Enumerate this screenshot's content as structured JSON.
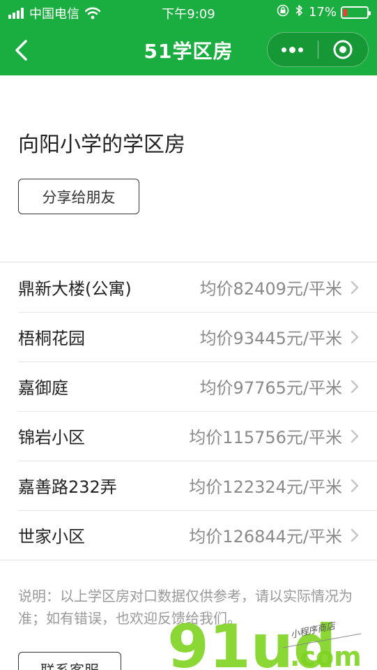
{
  "status_bar": {
    "carrier": "中国电信",
    "time": "下午9:09",
    "battery_percent": "17%",
    "battery_level": 0.17,
    "battery_color": "#ff3b30"
  },
  "header": {
    "title": "51学区房",
    "background_color": "#1aad3f"
  },
  "page": {
    "heading": "向阳小学的学区房",
    "share_button_label": "分享给朋友",
    "listings": [
      {
        "name": "鼎新大楼(公寓)",
        "price": "均价82409元/平米"
      },
      {
        "name": "梧桐花园",
        "price": "均价93445元/平米"
      },
      {
        "name": "嘉御庭",
        "price": "均价97765元/平米"
      },
      {
        "name": "锦岩小区",
        "price": "均价115756元/平米"
      },
      {
        "name": "嘉善路232弄",
        "price": "均价122324元/平米"
      },
      {
        "name": "世家小区",
        "price": "均价126844元/平米"
      }
    ],
    "notice": "说明：以上学区房对口数据仅供参考，请以实际情况为准；如有错误，也欢迎反馈给我们。",
    "contact_button_label": "联系客服"
  },
  "watermark": {
    "logo_text": "91ud",
    "domain_text": ".com",
    "slogan": "小程序商店",
    "color": "#7ed321"
  }
}
